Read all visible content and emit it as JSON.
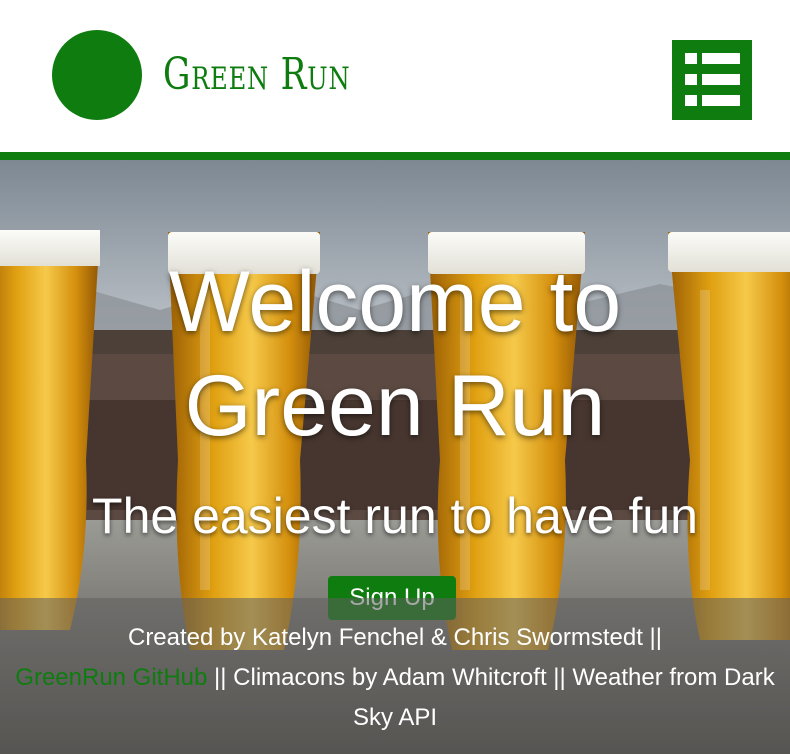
{
  "header": {
    "brand": "Green Run",
    "menu_icon": "list-menu-icon"
  },
  "hero": {
    "title_line1": "Welcome to",
    "title_line2": "Green Run",
    "subtitle": "The easiest run to have fun",
    "signup_label": "Sign Up"
  },
  "footer": {
    "text_before": "Created by Katelyn Fenchel & Chris Swormstedt ||",
    "github_link": "GreenRun GitHub",
    "text_after": "|| Climacons by Adam Whitcroft || Weather from Dark Sky API"
  },
  "colors": {
    "brand_green": "#0f7c0f",
    "white": "#ffffff"
  }
}
